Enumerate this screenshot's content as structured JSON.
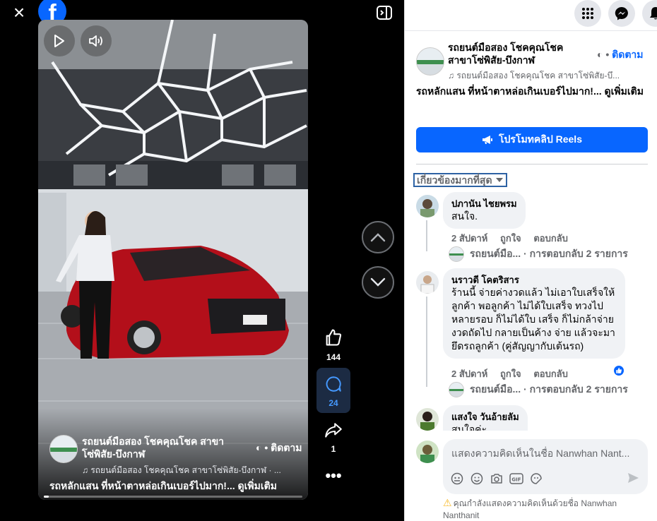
{
  "viewer": {
    "close_icon": "×",
    "video": {
      "page_name": "รถยนต์มือสอง โชคคุณโชค สาขาโซ่พิสัย-บึงกาฬ",
      "follow_prefix": "•",
      "follow_label": "ติดตาม",
      "audio_text": "♫ รถยนต์มือสอง โชคคุณโชค สาขาโซ่พิสัย-บึงกาฬ · ...",
      "caption": "รถหลักแสน ที่หน้าตาหล่อเกินเบอร์ไปมาก!... ดูเพิ่มเติม",
      "progress_fraction": 0.02
    },
    "actions": {
      "likes": "144",
      "comments": "24",
      "shares": "1"
    }
  },
  "panel": {
    "post": {
      "page_name": "รถยนต์มือสอง โชคคุณโชค สาขาโซ่พิสัย-บึงกาฬ",
      "follow_prefix": "•",
      "follow_label": "ติดตาม",
      "audio_text": "♫ รถยนต์มือสอง โชคคุณโชค สาขาโซ่พิสัย-บึ...",
      "caption": "รถหลักแสน ที่หน้าตาหล่อเกินเบอร์ไปมาก!... ดูเพิ่มเติม"
    },
    "promo_label": "โปรโมทคลิป Reels",
    "sort_label": "เกี่ยวข้องมากที่สุด",
    "comments": [
      {
        "author": "ปภานัน ไชยพรม",
        "text": "สนใจ.",
        "time": "2 สัปดาห์",
        "like": "ถูกใจ",
        "reply": "ตอบกลับ",
        "reply_preview": "รถยนต์มือ... · การตอบกลับ 2 รายการ"
      },
      {
        "author": "นราวดี โคตริสาร",
        "text": "ร้านนี้ จ่ายค่างวดแล้ว ไม่เอาใบเสร็จให้ลูกค้า พอลูกค้า ไม่ได้ใบเสร็จ ทวงไปหลายรอบ ก็ไม่ได้ใบ เสร็จ ก็ไม่กล้าจ่ายงวดถัดไป กลายเป็นค้าง จ่าย แล้วจะมายึดรถลูกค้า (คู่สัญญากับเต้นรถ)",
        "time": "2 สัปดาห์",
        "like": "ถูกใจ",
        "reply": "ตอบกลับ",
        "reply_preview": "รถยนต์มือ... · การตอบกลับ 2 รายการ"
      },
      {
        "author": "แสงใจ วันอ้ายลัม",
        "text": "สนใจค่ะ"
      }
    ],
    "composer": {
      "placeholder": "แสดงความคิดเห็นในชื่อ Nanwhan Nant...",
      "gif_label": "GIF",
      "warning": "คุณกำลังแสดงความคิดเห็นด้วยชื่อ Nanwhan Nanthanit"
    },
    "colors": {
      "brand": "#0866ff",
      "like_blue": "#0866ff",
      "car_red": "#c3101c"
    }
  }
}
